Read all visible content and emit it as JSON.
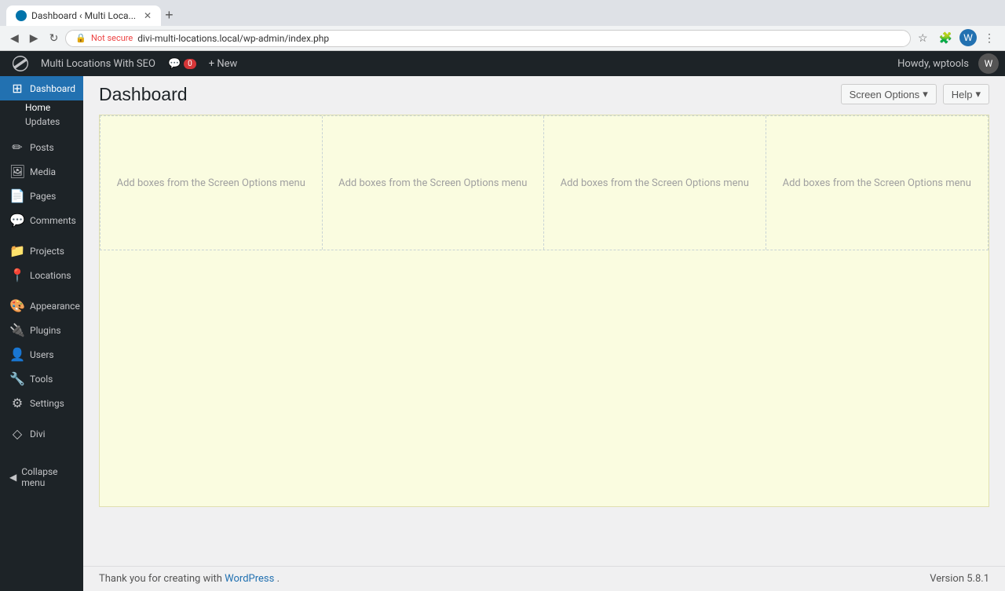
{
  "browser": {
    "tab_title": "Dashboard ‹ Multi Loca...",
    "tab_new_label": "+",
    "address": "divi-multi-locations.local/wp-admin/index.php",
    "not_secure_label": "Not secure",
    "back_label": "◀",
    "forward_label": "▶",
    "refresh_label": "↻"
  },
  "admin_bar": {
    "wp_icon": "W",
    "site_name": "Multi Locations With SEO",
    "comments_count": "0",
    "new_label": "+ New",
    "howdy": "Howdy, wptools",
    "avatar_label": "W"
  },
  "sidebar": {
    "items": [
      {
        "id": "dashboard",
        "label": "Dashboard",
        "icon": "⊞",
        "active": true
      },
      {
        "id": "posts",
        "label": "Posts",
        "icon": "📝"
      },
      {
        "id": "media",
        "label": "Media",
        "icon": "🖼"
      },
      {
        "id": "pages",
        "label": "Pages",
        "icon": "📄"
      },
      {
        "id": "comments",
        "label": "Comments",
        "icon": "💬"
      },
      {
        "id": "projects",
        "label": "Projects",
        "icon": "📁"
      },
      {
        "id": "locations",
        "label": "Locations",
        "icon": "📍"
      },
      {
        "id": "appearance",
        "label": "Appearance",
        "icon": "🎨"
      },
      {
        "id": "plugins",
        "label": "Plugins",
        "icon": "🔌"
      },
      {
        "id": "users",
        "label": "Users",
        "icon": "👤"
      },
      {
        "id": "tools",
        "label": "Tools",
        "icon": "🔧"
      },
      {
        "id": "settings",
        "label": "Settings",
        "icon": "⚙"
      },
      {
        "id": "divi",
        "label": "Divi",
        "icon": "◇"
      }
    ],
    "sub_items": [
      {
        "parent": "dashboard",
        "label": "Home",
        "active": true
      },
      {
        "parent": "dashboard",
        "label": "Updates"
      }
    ],
    "collapse_label": "Collapse menu"
  },
  "header": {
    "page_title": "Dashboard",
    "screen_options_label": "Screen Options",
    "screen_options_arrow": "▾",
    "help_label": "Help",
    "help_arrow": "▾"
  },
  "dashboard": {
    "placeholder_text": "Add boxes from the Screen Options menu",
    "columns": [
      {
        "id": "col1",
        "placeholder": "Add boxes from the Screen Options menu"
      },
      {
        "id": "col2",
        "placeholder": "Add boxes from the Screen Options menu"
      },
      {
        "id": "col3",
        "placeholder": "Add boxes from the Screen Options menu"
      },
      {
        "id": "col4",
        "placeholder": "Add boxes from the Screen Options menu"
      }
    ]
  },
  "footer": {
    "thank_you_text": "Thank you for creating with ",
    "wp_link_label": "WordPress",
    "version_label": "Version 5.8.1"
  }
}
